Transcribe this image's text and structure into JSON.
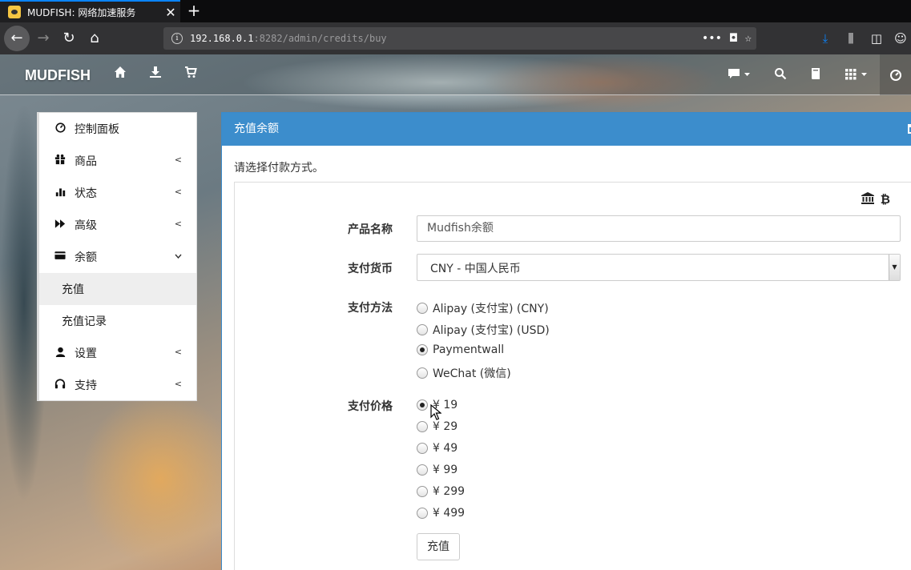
{
  "browser": {
    "tab_title": "MUDFISH: 网络加速服务",
    "tab_close": "✕",
    "new_tab": "+",
    "url_host": "192.168.0.1",
    "url_rest": ":8282/admin/credits/buy",
    "url_more": "•••"
  },
  "app": {
    "brand": "MUDFISH"
  },
  "sidebar": {
    "items": [
      {
        "label": "控制面板"
      },
      {
        "label": "商品"
      },
      {
        "label": "状态"
      },
      {
        "label": "高级"
      },
      {
        "label": "余额"
      },
      {
        "label": "设置"
      },
      {
        "label": "支持"
      }
    ],
    "sub_items": [
      {
        "label": "充值"
      },
      {
        "label": "充值记录"
      }
    ]
  },
  "panel": {
    "title": "充值余额",
    "intro": "请选择付款方式。"
  },
  "form": {
    "product_label": "产品名称",
    "product_value": "Mudfish余额",
    "currency_label": "支付货币",
    "currency_value": "CNY - 中国人民币",
    "method_label": "支付方法",
    "methods": [
      {
        "label": "Alipay (支付宝) (CNY)",
        "checked": false
      },
      {
        "label": "Alipay (支付宝) (USD)",
        "checked": false
      },
      {
        "label": "Paymentwall",
        "checked": true
      },
      {
        "label": "WeChat (微信)",
        "checked": false
      }
    ],
    "price_label": "支付价格",
    "prices": [
      {
        "label": "¥ 19",
        "checked": true
      },
      {
        "label": "¥ 29",
        "checked": false
      },
      {
        "label": "¥ 49",
        "checked": false
      },
      {
        "label": "¥ 99",
        "checked": false
      },
      {
        "label": "¥ 299",
        "checked": false
      },
      {
        "label": "¥ 499",
        "checked": false
      }
    ],
    "submit_label": "充值"
  }
}
